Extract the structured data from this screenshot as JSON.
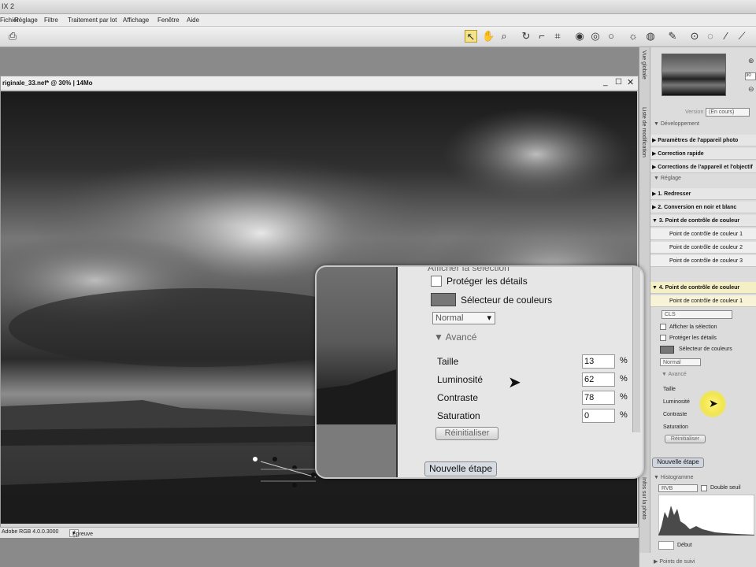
{
  "window": {
    "title": "IX 2"
  },
  "menu": [
    "Fichier",
    "Réglage",
    "Filtre",
    "Traitement par lot",
    "Affichage",
    "Fenêtre",
    "Aide"
  ],
  "toolbar_icons": [
    "direct-select-icon",
    "hand-icon",
    "zoom-icon",
    "rotate-icon",
    "straighten-icon",
    "crop-icon",
    "control-point-black-icon",
    "control-point-white-icon",
    "control-point-neutral-icon",
    "color-control-point-icon",
    "red-eye-icon",
    "brush-icon",
    "lasso-icon",
    "selection-icon",
    "line-icon"
  ],
  "document": {
    "title": "riginale_33.nef* @ 30% | 14Mo",
    "status_profile": "Adobe RGB 4.0.0.3000",
    "status_proof": "Épreuve écran désactivée"
  },
  "right_panel": {
    "tabs": [
      "Vue globale",
      "Liste de modification",
      "Infos sur la photo"
    ],
    "zoom_value": "30",
    "version_label": "Version",
    "version_value": "(En cours)",
    "development_header": "Développement",
    "development_items": [
      "Paramètres de l'appareil photo",
      "Correction rapide",
      "Corrections de l'appareil et l'objectif"
    ],
    "adjust_header": "Réglage",
    "adjust_items": [
      "1. Redresser",
      "2. Conversion en noir et blanc",
      "3. Point de contrôle de couleur"
    ],
    "cp_items": [
      "Point de contrôle de couleur 1",
      "Point de contrôle de couleur 2",
      "Point de contrôle de couleur 3"
    ],
    "step4": "4. Point de contrôle de couleur",
    "step4_item": "Point de contrôle de couleur 1",
    "mode_value": "CLS",
    "show_selection": "Afficher la sélection",
    "protect_details": "Protéger les détails",
    "color_picker": "Sélecteur de couleurs",
    "blend": "Normal",
    "advanced": "Avancé",
    "fields": [
      "Taille",
      "Luminosité",
      "Contraste",
      "Saturation"
    ],
    "reset": "Réinitialiser",
    "new_step": "Nouvelle étape",
    "histogram_header": "Histogramme",
    "histogram_channel": "RVB",
    "histogram_mode": "Double seuil",
    "start_label": "Début",
    "follow_points": "Points de suivi"
  },
  "zoom_panel": {
    "show_selection": "Afficher la sélection",
    "protect_details": "Protéger les détails",
    "color_picker": "Sélecteur de couleurs",
    "blend": "Normal",
    "advanced": "Avancé",
    "fields": [
      {
        "label": "Taille",
        "value": "13",
        "unit": "%"
      },
      {
        "label": "Luminosité",
        "value": "62",
        "unit": "%"
      },
      {
        "label": "Contraste",
        "value": "78",
        "unit": "%"
      },
      {
        "label": "Saturation",
        "value": "0",
        "unit": "%"
      }
    ],
    "reset": "Réinitialiser",
    "new_step": "Nouvelle étape"
  }
}
